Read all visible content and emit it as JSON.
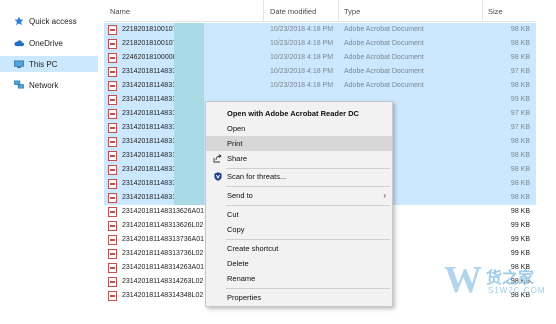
{
  "nav": {
    "items": [
      {
        "label": "Quick access",
        "icon": "star-icon"
      },
      {
        "label": "OneDrive",
        "icon": "cloud-icon"
      },
      {
        "label": "This PC",
        "icon": "computer-icon"
      },
      {
        "label": "Network",
        "icon": "network-icon"
      }
    ]
  },
  "columns": {
    "name": "Name",
    "date": "Date modified",
    "type": "Type",
    "size": "Size"
  },
  "files": [
    {
      "name": "22182018100107",
      "date": "10/23/2018 4:18 PM",
      "type": "Adobe Acrobat Document",
      "size": "98 KB",
      "selected": true
    },
    {
      "name": "22182018100107",
      "date": "10/23/2018 4:18 PM",
      "type": "Adobe Acrobat Document",
      "size": "98 KB",
      "selected": true
    },
    {
      "name": "22462018100008",
      "date": "10/23/2018 4:18 PM",
      "type": "Adobe Acrobat Document",
      "size": "98 KB",
      "selected": true
    },
    {
      "name": "23142018114831",
      "date": "10/23/2018 4:18 PM",
      "type": "Adobe Acrobat Document",
      "size": "97 KB",
      "selected": true
    },
    {
      "name": "23142018114831",
      "date": "10/23/2018 4:18 PM",
      "type": "Adobe Acrobat Document",
      "size": "98 KB",
      "selected": true
    },
    {
      "name": "23142018114831",
      "date": "",
      "type": "",
      "size": "99 KB",
      "selected": true
    },
    {
      "name": "23142018114831",
      "date": "",
      "type": "",
      "size": "97 KB",
      "selected": true
    },
    {
      "name": "23142018114831",
      "date": "",
      "type": "",
      "size": "97 KB",
      "selected": true
    },
    {
      "name": "23142018114831",
      "date": "",
      "type": "",
      "size": "98 KB",
      "selected": true
    },
    {
      "name": "23142018114831",
      "date": "",
      "type": "",
      "size": "98 KB",
      "selected": true
    },
    {
      "name": "23142018114831",
      "date": "",
      "type": "",
      "size": "98 KB",
      "selected": true
    },
    {
      "name": "23142018114831",
      "date": "",
      "type": "",
      "size": "98 KB",
      "selected": true
    },
    {
      "name": "23142018114831",
      "date": "",
      "type": "",
      "size": "98 KB",
      "selected": true
    },
    {
      "name": "231420181148313626A01",
      "date": "",
      "type": "",
      "size": "98 KB",
      "selected": false
    },
    {
      "name": "231420181148313626L02",
      "date": "",
      "type": "",
      "size": "99 KB",
      "selected": false
    },
    {
      "name": "231420181148313736A01",
      "date": "",
      "type": "",
      "size": "99 KB",
      "selected": false
    },
    {
      "name": "231420181148313736L02",
      "date": "",
      "type": "",
      "size": "99 KB",
      "selected": false
    },
    {
      "name": "231420181148314263A01",
      "date": "",
      "type": "",
      "size": "98 KB",
      "selected": false
    },
    {
      "name": "231420181148314263L02",
      "date": "",
      "type": "",
      "size": "98 KB",
      "selected": false
    },
    {
      "name": "231420181148314348L02",
      "date": "",
      "type": "",
      "size": "98 KB",
      "selected": false
    }
  ],
  "menu": {
    "open_with": "Open with Adobe Acrobat Reader DC",
    "open": "Open",
    "print": "Print",
    "share": "Share",
    "scan": "Scan for threats...",
    "send_to": "Send to",
    "cut": "Cut",
    "copy": "Copy",
    "create_shortcut": "Create shortcut",
    "delete": "Delete",
    "rename": "Rename",
    "properties": "Properties"
  },
  "watermark": {
    "letter": "W",
    "cn": "货之家",
    "en": "S1W2C.COM"
  },
  "colors": {
    "selection": "#cce8ff",
    "menu_bg": "#f2f2f2",
    "menu_highlight": "#d7d7d7",
    "pdf_icon": "#c0504d"
  }
}
